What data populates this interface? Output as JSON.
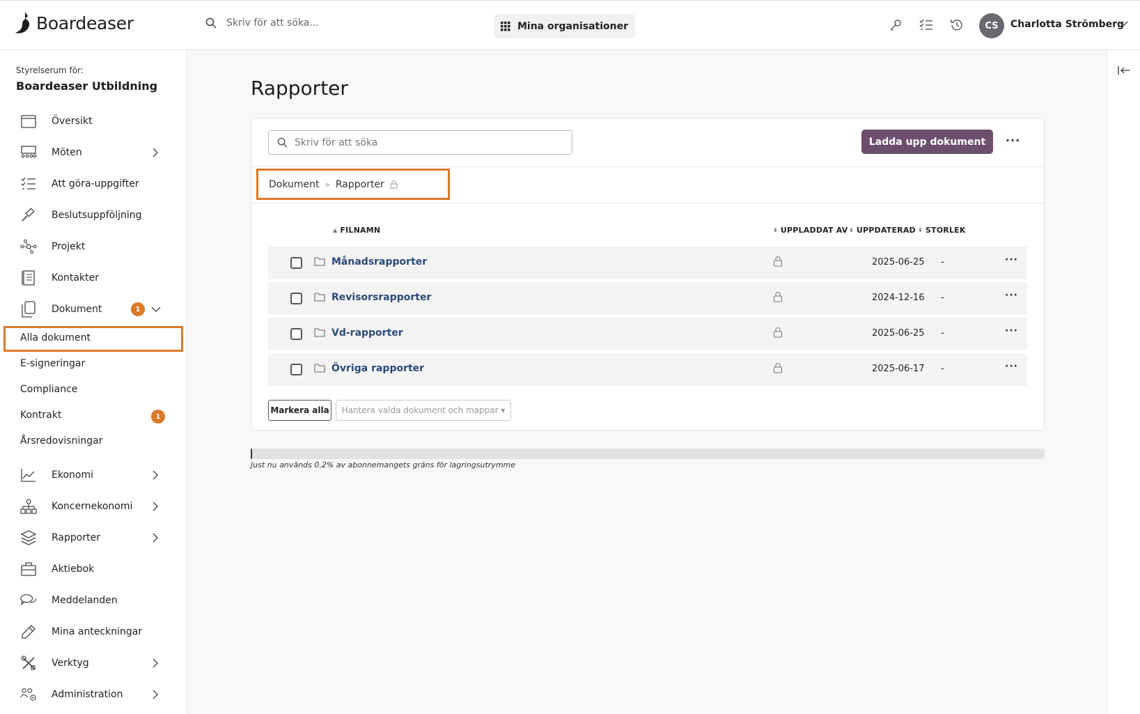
{
  "header": {
    "logo_text": "Boardeaser",
    "search_placeholder": "Skriv för att söka...",
    "org_button": "Mina organisationer",
    "user_initials": "CS",
    "user_name": "Charlotta Strömberg"
  },
  "sidebar": {
    "caption": "Styrelserum för:",
    "board_name": "Boardeaser Utbildning",
    "items": [
      {
        "label": "Översikt",
        "icon": "calendar-icon"
      },
      {
        "label": "Möten",
        "icon": "meeting-icon"
      },
      {
        "label": "Att göra-uppgifter",
        "icon": "checklist-icon"
      },
      {
        "label": "Beslutsuppföljning",
        "icon": "gavel-icon"
      },
      {
        "label": "Projekt",
        "icon": "network-icon"
      },
      {
        "label": "Kontakter",
        "icon": "contacts-icon"
      },
      {
        "label": "Dokument",
        "icon": "documents-icon",
        "badge": "1"
      },
      {
        "label": "Ekonomi",
        "icon": "chart-icon"
      },
      {
        "label": "Koncernekonomi",
        "icon": "hierarchy-icon"
      },
      {
        "label": "Rapporter",
        "icon": "layers-icon"
      },
      {
        "label": "Aktiebok",
        "icon": "briefcase-icon"
      },
      {
        "label": "Meddelanden",
        "icon": "chat-icon"
      },
      {
        "label": "Mina anteckningar",
        "icon": "pencil-icon"
      },
      {
        "label": "Verktyg",
        "icon": "tools-icon"
      },
      {
        "label": "Administration",
        "icon": "admin-icon"
      }
    ],
    "sub_items": [
      {
        "label": "Alla dokument"
      },
      {
        "label": "E-signeringar"
      },
      {
        "label": "Compliance"
      },
      {
        "label": "Kontrakt",
        "badge": "1"
      },
      {
        "label": "Årsredovisningar"
      }
    ]
  },
  "main": {
    "title": "Rapporter",
    "search_placeholder": "Skriv för att söka",
    "upload_label": "Ladda upp dokument",
    "more_label": "···",
    "breadcrumb": [
      "Dokument",
      "Rapporter"
    ],
    "columns": {
      "filename": "FILNAMN",
      "uploaded_by": "UPPLADDAT AV",
      "updated": "UPPDATERAD",
      "size": "STORLEK"
    },
    "rows": [
      {
        "name": "Månadsrapporter",
        "updated": "2025-06-25",
        "size": "-"
      },
      {
        "name": "Revisorsrapporter",
        "updated": "2024-12-16",
        "size": "-"
      },
      {
        "name": "Vd-rapporter",
        "updated": "2025-06-25",
        "size": "-"
      },
      {
        "name": "Övriga rapporter",
        "updated": "2025-06-17",
        "size": "-"
      }
    ],
    "row_more": "···",
    "mark_all": "Markera alla",
    "manage_selected": "Hantera valda dokument och mappar ▾",
    "storage_used_fraction": 0.002,
    "storage_text": "Just nu används 0.2% av abonnemangets gräns för lagringsutrymme"
  },
  "colors": {
    "accent": "#6c4f6d",
    "highlight": "#d97a2b",
    "link": "#2b4a7a"
  }
}
